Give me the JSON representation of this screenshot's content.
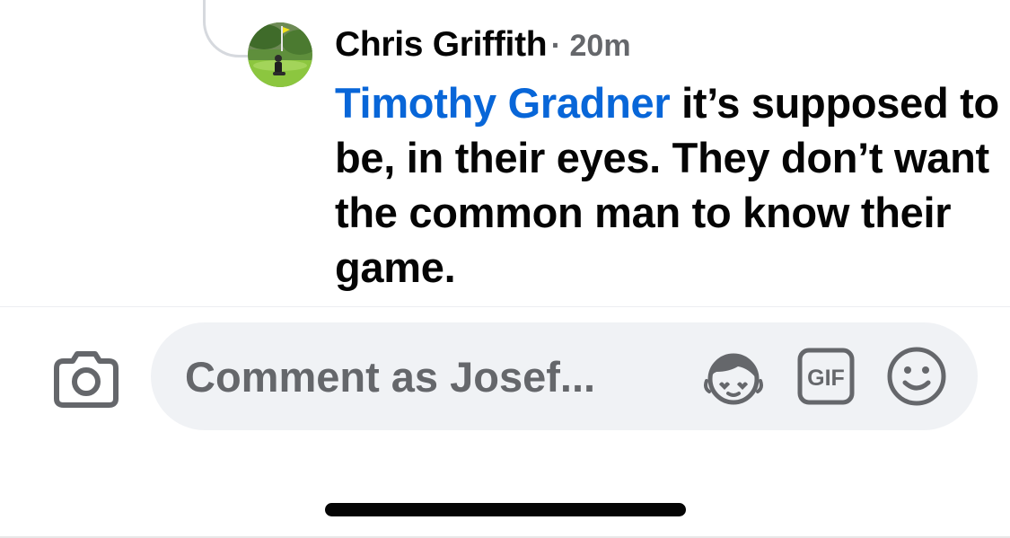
{
  "comment": {
    "author": "Chris Griffith",
    "time": "· 20m",
    "mention": "Timothy Gradner",
    "text": " it’s supposed to be, in their eyes. They don’t want the common man to know their game.",
    "avatar_icon": "profile-photo-golfer"
  },
  "composer": {
    "placeholder": "Comment as Josef...",
    "camera_icon": "camera-icon",
    "avatar_sticker_icon": "avatar-sticker-icon",
    "gif_label": "GIF",
    "emoji_icon": "emoji-icon"
  },
  "colors": {
    "mention": "#0866d8",
    "text": "#050505",
    "secondary": "#65676b",
    "field_bg": "#f0f2f5",
    "icon": "#65676b"
  }
}
